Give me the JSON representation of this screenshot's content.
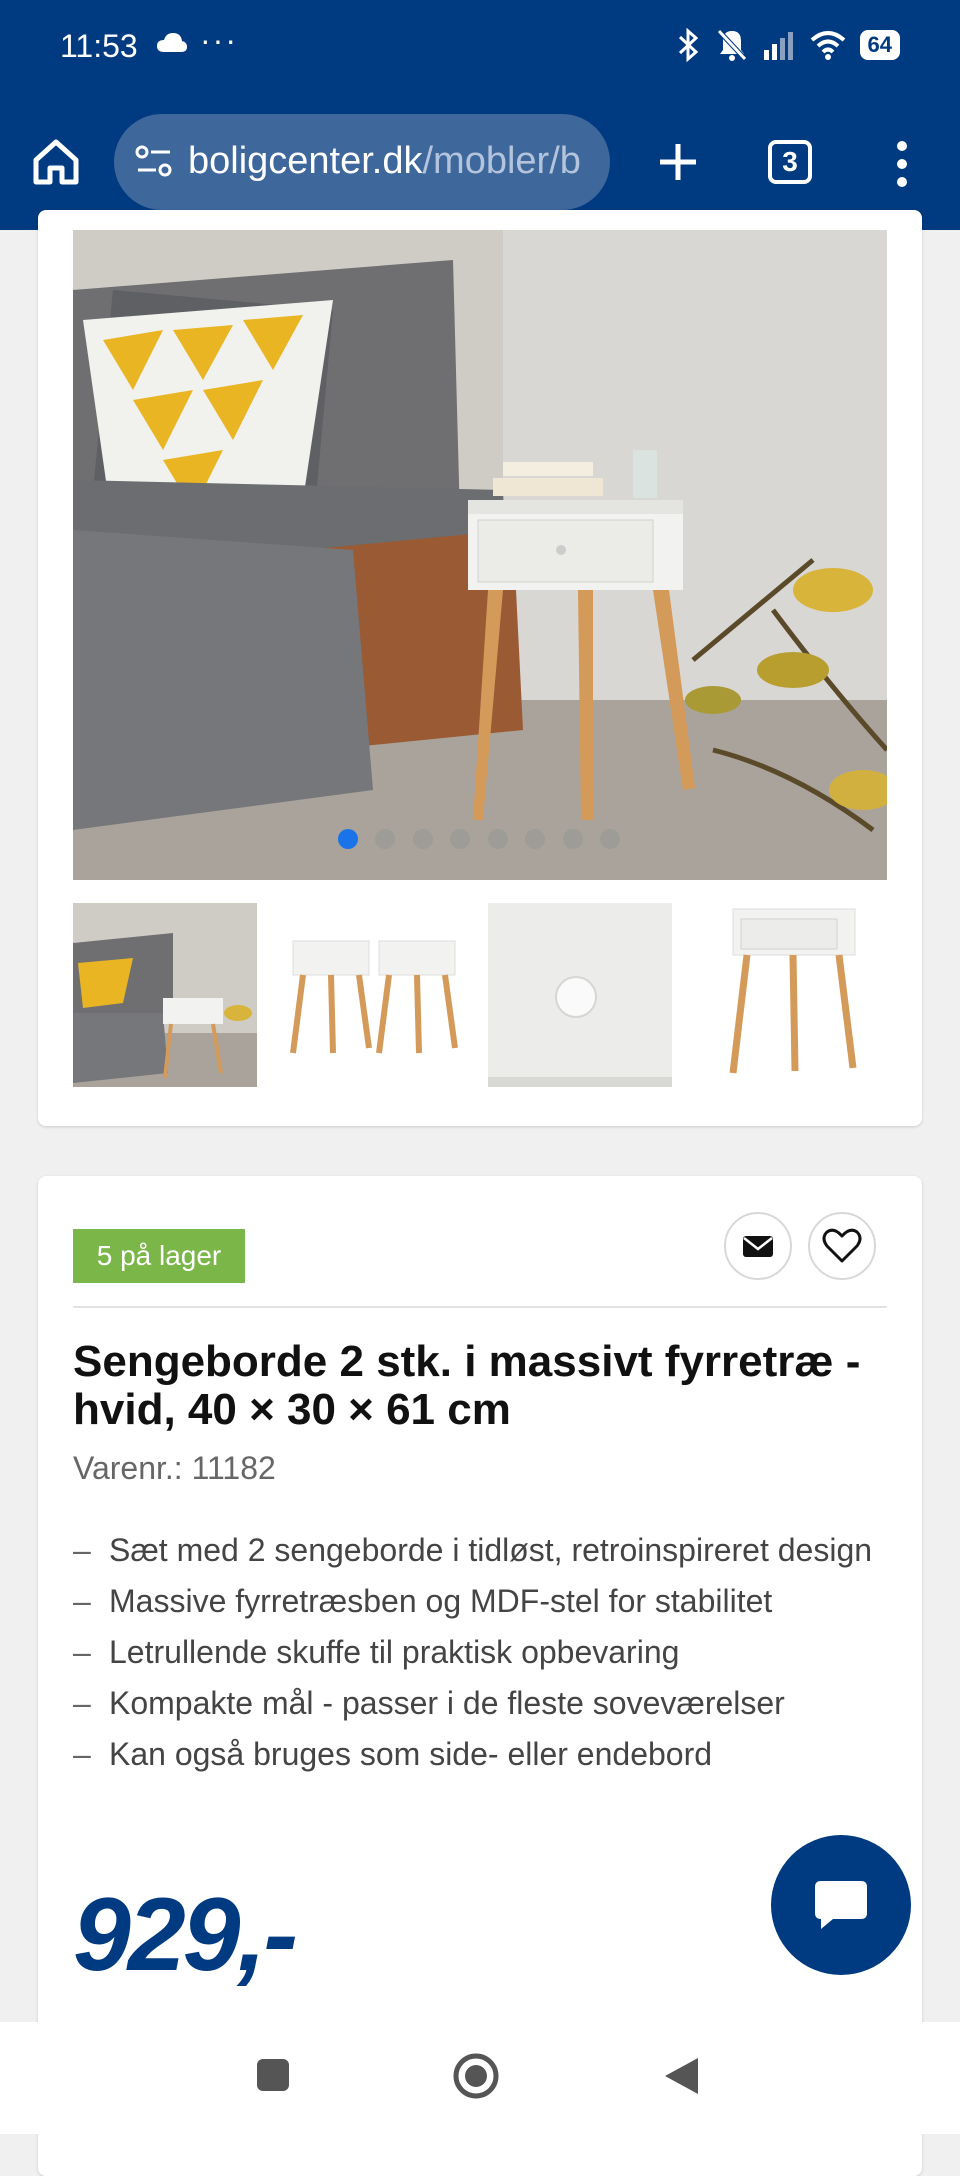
{
  "status_bar": {
    "time": "11:53",
    "more": "···",
    "battery": "64"
  },
  "browser": {
    "url_host": "boligcenter.dk",
    "url_path": "/mobler/b",
    "tab_count": "3"
  },
  "product": {
    "stock_label": "5 på lager",
    "title": "Sengeborde 2 stk. i massivt fyrretræ - hvid, 40 × 30 × 61 cm",
    "sku": "Varenr.: 11182",
    "features": [
      "Sæt med 2 sengeborde i tidløst, retroinspireret design",
      "Massive fyrretræsben og MDF-stel for stabilitet",
      "Letrullende skuffe til praktisk opbevaring",
      "Kompakte mål - passer i de fleste soveværelser",
      "Kan også bruges som side- eller endebord"
    ],
    "price": "929,-",
    "gallery": {
      "dot_count": 8,
      "active_dot": 1
    }
  },
  "colors": {
    "brand_blue": "#003a80",
    "stock_green": "#7ab648",
    "active_dot": "#1a73e8"
  }
}
